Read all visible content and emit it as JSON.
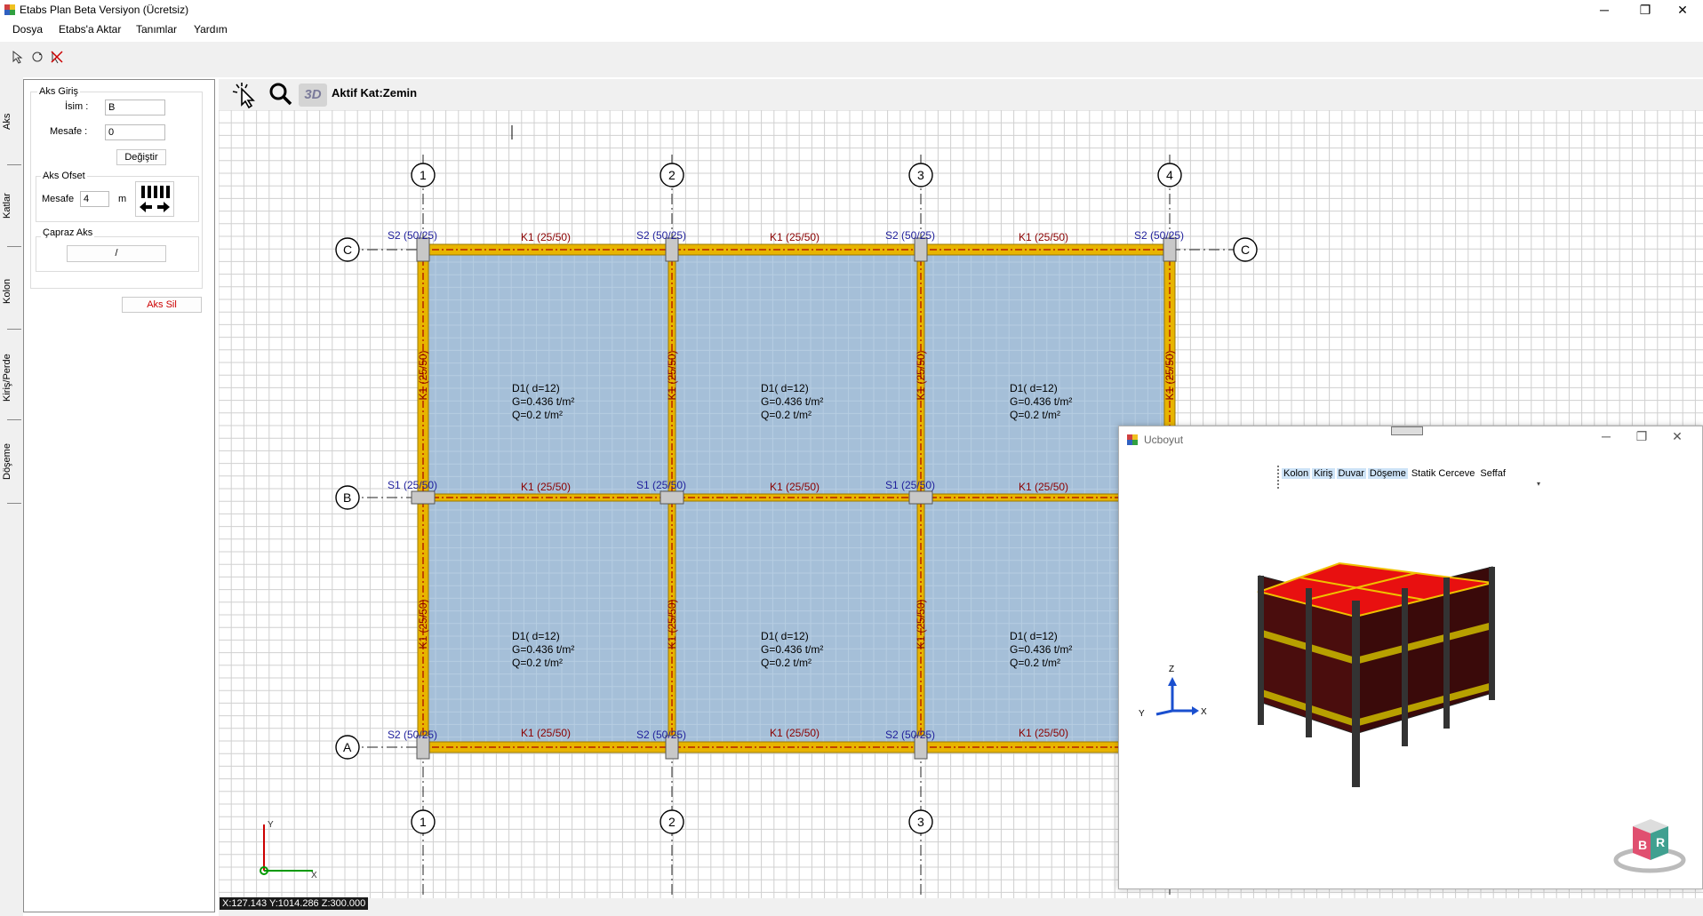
{
  "window": {
    "title": "Etabs Plan Beta Versiyon (Ücretsiz)",
    "minimize": "─",
    "maximize": "❐",
    "close": "✕"
  },
  "menu": [
    "Dosya",
    "Etabs'a Aktar",
    "Tanımlar",
    "Yardım"
  ],
  "canvas_toolbar": {
    "active_floor": "Aktif Kat:Zemin",
    "icon_3d": "3D"
  },
  "tabs": [
    "Aks",
    "Katlar",
    "Kolon",
    "Kiriş/Perde",
    "Döşeme"
  ],
  "panel": {
    "aks_giris_title": "Aks Giriş",
    "isim_label": "İsim :",
    "isim_value": "B",
    "mesafe_label": "Mesafe :",
    "mesafe_value": "0",
    "degistir": "Değiştir",
    "aks_ofset_title": "Aks Ofset",
    "ofset_mesafe_label": "Mesafe",
    "ofset_value": "4",
    "ofset_unit": "m",
    "capraz_title": "Çapraz Aks",
    "capraz_button": "/",
    "aks_sil": "Aks Sil"
  },
  "plan": {
    "x_axes": [
      "1",
      "2",
      "3",
      "4"
    ],
    "y_axes": [
      "C",
      "B",
      "A"
    ],
    "beam_label": "K1 (25/50)",
    "column_s2": "S2 (50/25)",
    "column_s1": "S1 (25/50)",
    "slab": {
      "name": "D1( d=12)",
      "g": "G=0.436 t/m²",
      "q": "Q=0.2 t/m²"
    },
    "colors": {
      "slab": "#a5bfd8",
      "beam": "#e8b400",
      "grid": "#d0d0d0",
      "axis_label": "#8b0000",
      "column_label": "#1e1e9b"
    }
  },
  "axis_indicator": {
    "x": "X",
    "y": "Y"
  },
  "status": "X:127.143 Y:1014.286 Z:300.000",
  "win3d": {
    "title": "Ucboyut",
    "checkboxes": [
      {
        "label": "Kolon",
        "checked": true
      },
      {
        "label": "Kiriş",
        "checked": true
      },
      {
        "label": "Duvar",
        "checked": true
      },
      {
        "label": "Döşeme",
        "checked": true
      },
      {
        "label": "Statik Cerceve",
        "checked": false
      },
      {
        "label": "Seffaf",
        "checked": false
      }
    ],
    "cube_letters": [
      "B",
      "R"
    ],
    "axes": {
      "x": "X",
      "y": "Y",
      "z": "Z"
    }
  }
}
